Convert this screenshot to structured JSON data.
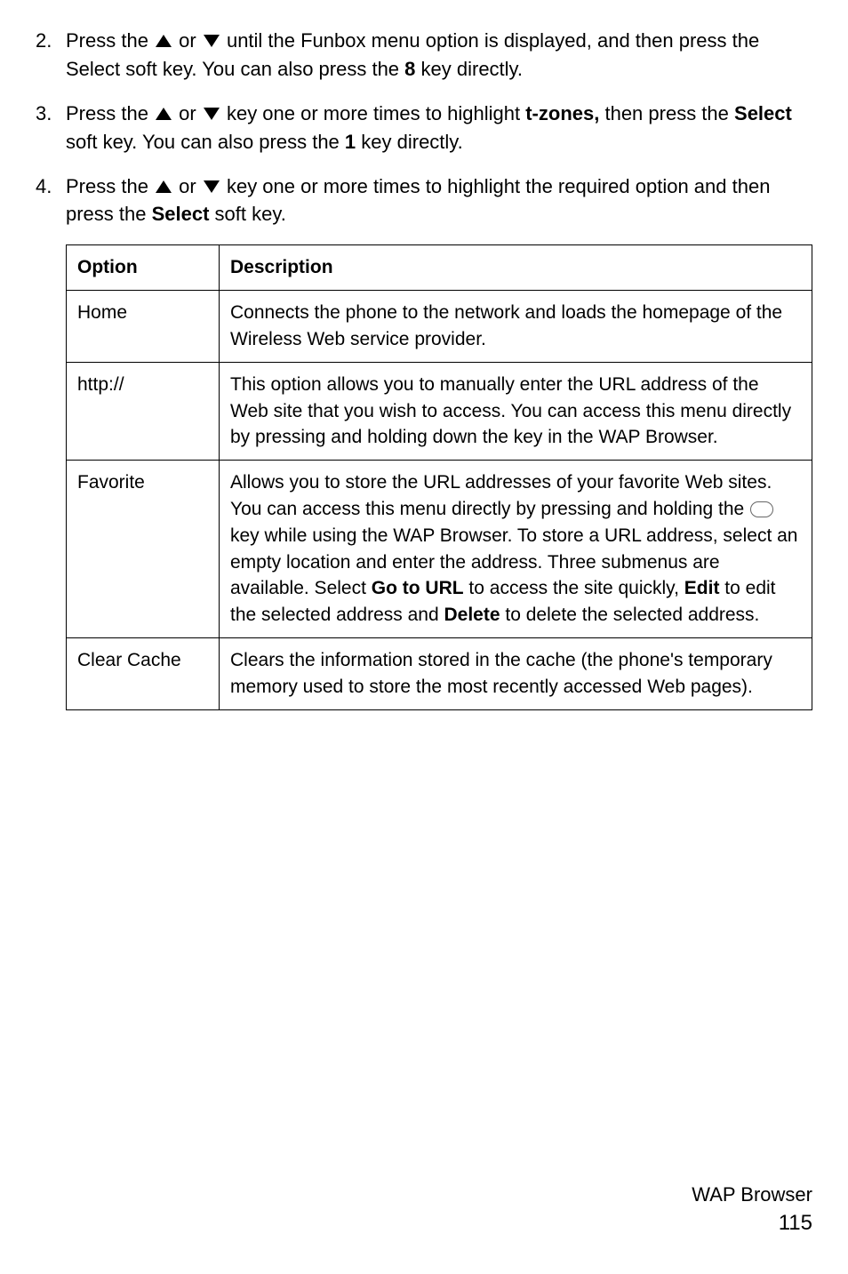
{
  "list_items": [
    {
      "num": "2.",
      "parts": [
        {
          "t": "Press the ",
          "b": false
        },
        {
          "icon": "up"
        },
        {
          "t": " or ",
          "b": false
        },
        {
          "icon": "down"
        },
        {
          "t": " until the Funbox menu option is displayed, and then press the Select soft key. You can also press the ",
          "b": false
        },
        {
          "t": "8",
          "b": true
        },
        {
          "t": " key directly.",
          "b": false
        }
      ]
    },
    {
      "num": "3.",
      "parts": [
        {
          "t": "Press the ",
          "b": false
        },
        {
          "icon": "up"
        },
        {
          "t": " or ",
          "b": false
        },
        {
          "icon": "down"
        },
        {
          "t": " key one or more times to highlight ",
          "b": false
        },
        {
          "t": "t-zones,",
          "b": true
        },
        {
          "t": " then press the ",
          "b": false
        },
        {
          "t": "Select",
          "b": true
        },
        {
          "t": " soft key. You can also press the ",
          "b": false
        },
        {
          "t": "1",
          "b": true
        },
        {
          "t": " key directly.",
          "b": false
        }
      ]
    },
    {
      "num": "4.",
      "parts": [
        {
          "t": "Press the ",
          "b": false
        },
        {
          "icon": "up"
        },
        {
          "t": " or ",
          "b": false
        },
        {
          "icon": "down"
        },
        {
          "t": " key one or more times to highlight the required option and then press the ",
          "b": false
        },
        {
          "t": "Select",
          "b": true
        },
        {
          "t": " soft key.",
          "b": false
        }
      ]
    }
  ],
  "table": {
    "header_option": "Option",
    "header_description": "Description",
    "rows": [
      {
        "option": "Home",
        "desc": [
          {
            "t": "Connects the phone to the network and loads the homepage of the Wireless Web service provider.",
            "b": false
          }
        ]
      },
      {
        "option": "http://",
        "desc": [
          {
            "t": "This option allows you to manually enter the URL address of the Web site that you wish to access. You can access this menu directly by pressing and holding down the key in the WAP Browser.",
            "b": false
          }
        ]
      },
      {
        "option": "Favorite",
        "desc": [
          {
            "t": "Allows you to store the URL addresses of your favorite Web sites. You can access this menu directly by pressing and holding the ",
            "b": false
          },
          {
            "icon": "key"
          },
          {
            "t": " key while using the WAP Browser. To store a URL address, select an empty location and enter the address. Three submenus are available. Select ",
            "b": false
          },
          {
            "t": "Go to URL",
            "b": true
          },
          {
            "t": " to access the site quickly, ",
            "b": false
          },
          {
            "t": "Edit",
            "b": true
          },
          {
            "t": " to edit the selected address and ",
            "b": false
          },
          {
            "t": "Delete",
            "b": true
          },
          {
            "t": " to delete the selected address.",
            "b": false
          }
        ]
      },
      {
        "option": "Clear Cache",
        "desc": [
          {
            "t": "Clears the information stored in the cache (the phone's temporary memory used to store the most recently accessed Web pages).",
            "b": false
          }
        ]
      }
    ]
  },
  "footer": {
    "title": "WAP Browser",
    "page": "115"
  }
}
